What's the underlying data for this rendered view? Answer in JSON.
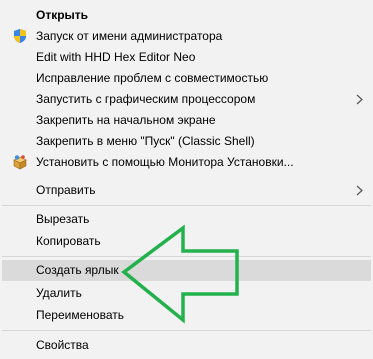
{
  "menu": {
    "items": [
      {
        "label": "Открыть",
        "icon": ""
      },
      {
        "label": "Запуск от имени администратора",
        "icon": "uac-shield-icon"
      },
      {
        "label": "Edit with HHD Hex Editor Neo",
        "icon": ""
      },
      {
        "label": "Исправление проблем с совместимостью",
        "icon": ""
      },
      {
        "label": "Запустить с графическим процессором",
        "icon": "",
        "submenu": true
      },
      {
        "label": "Закрепить на начальном экране",
        "icon": ""
      },
      {
        "label": "Закрепить в меню \"Пуск\" (Classic Shell)",
        "icon": ""
      },
      {
        "label": "Установить с помощью Монитора Установки...",
        "icon": "installer-box-icon"
      },
      {
        "label": "Отправить",
        "icon": "",
        "submenu": true
      },
      {
        "label": "Вырезать",
        "icon": ""
      },
      {
        "label": "Копировать",
        "icon": ""
      },
      {
        "label": "Создать ярлык",
        "icon": "",
        "highlighted": true
      },
      {
        "label": "Удалить",
        "icon": ""
      },
      {
        "label": "Переименовать",
        "icon": ""
      },
      {
        "label": "Свойства",
        "icon": ""
      }
    ]
  },
  "colors": {
    "menu_background": "#f2f2f2",
    "highlight": "#dadada",
    "separator": "#d7d7d7",
    "annotation_arrow": "#22b14c"
  },
  "annotation": {
    "icon": "arrow-left-outline-icon",
    "points_to": "Создать ярлык"
  }
}
